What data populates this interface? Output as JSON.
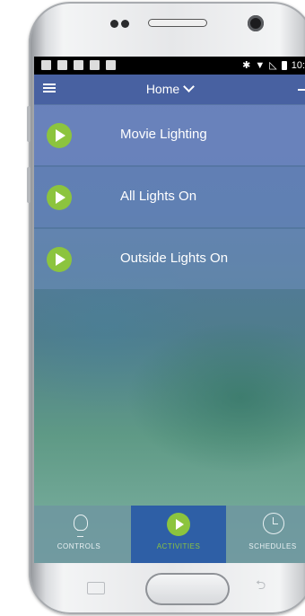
{
  "status_bar": {
    "left_icons": [
      "image-icon",
      "sim-icon",
      "check-icon",
      "bag-icon",
      "android-icon"
    ],
    "right_icons": [
      "bluetooth-icon",
      "wifi-icon",
      "no-signal-icon",
      "battery-icon"
    ],
    "time": "10:"
  },
  "app_bar": {
    "title": "Home",
    "menu_icon": "hamburger-icon",
    "dropdown_icon": "chevron-down-icon"
  },
  "activities": [
    {
      "label": "Movie Lighting",
      "icon": "play-icon"
    },
    {
      "label": "All Lights On",
      "icon": "play-icon"
    },
    {
      "label": "Outside Lights On",
      "icon": "play-icon"
    }
  ],
  "tabs": [
    {
      "label": "CONTROLS",
      "icon": "lightbulb-icon",
      "active": false
    },
    {
      "label": "ACTIVITIES",
      "icon": "play-icon",
      "active": true
    },
    {
      "label": "SCHEDULES",
      "icon": "clock-icon",
      "active": false
    }
  ],
  "colors": {
    "accent_green": "#8cc43e",
    "active_tab_blue": "#2e5fa6",
    "app_bar_blue": "#4860a0"
  }
}
